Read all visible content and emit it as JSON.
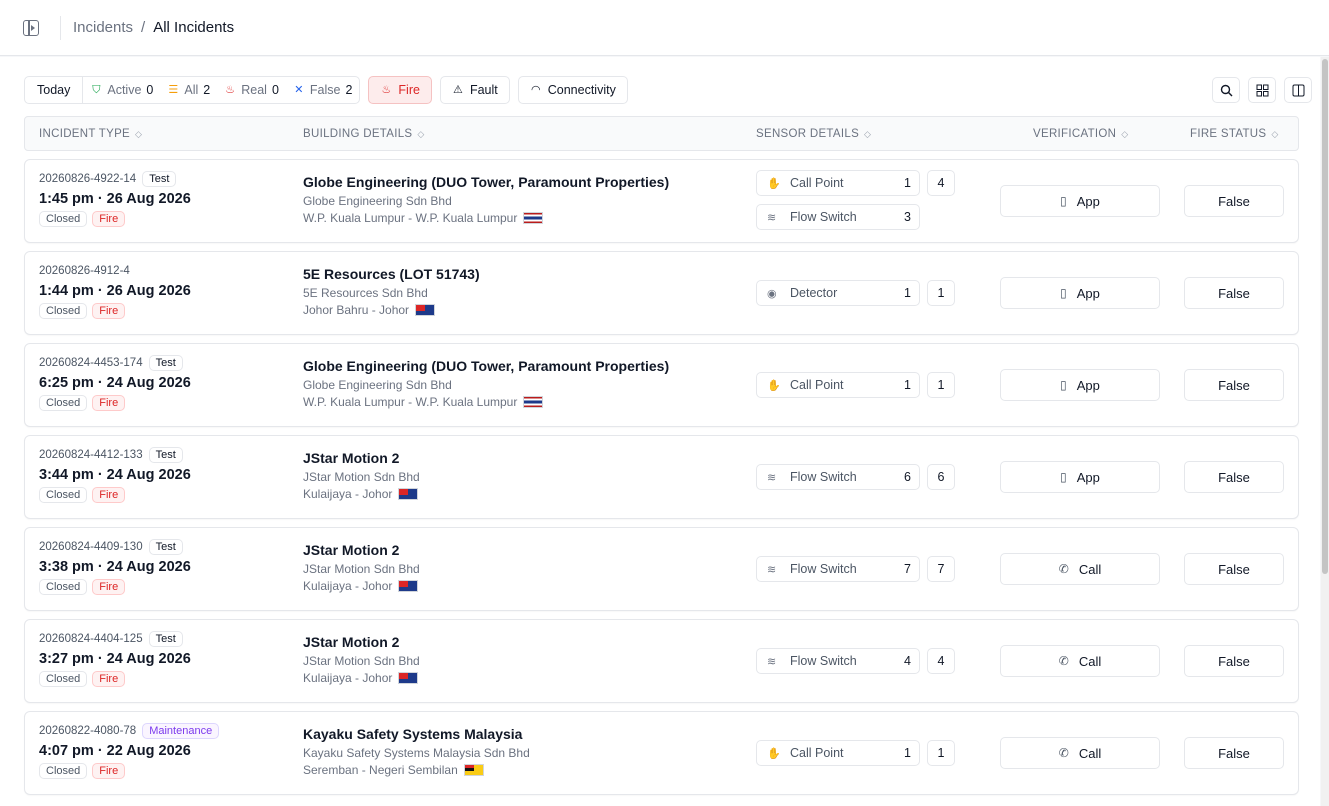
{
  "breadcrumb": {
    "parent": "Incidents",
    "separator": "/",
    "current": "All Incidents"
  },
  "filters": {
    "today": "Today",
    "active_label": "Active",
    "active_count": "0",
    "all_label": "All",
    "all_count": "2",
    "real_label": "Real",
    "real_count": "0",
    "false_label": "False",
    "false_count": "2",
    "fire": "Fire",
    "fault": "Fault",
    "connectivity": "Connectivity"
  },
  "columns": {
    "incident_type": "INCIDENT TYPE",
    "building_details": "BUILDING DETAILS",
    "sensor_details": "SENSOR DETAILS",
    "verification": "VERIFICATION",
    "fire_status": "FIRE STATUS"
  },
  "colors": {
    "fire": "#dc2626",
    "maintenance": "#7c3aed",
    "border": "#e5e7eb"
  },
  "rows": [
    {
      "id": "20260826-4922-14",
      "tag": "Test",
      "datetime": "1:45 pm · 26 Aug 2026",
      "status": "Closed",
      "type": "Fire",
      "building": "Globe Engineering (DUO Tower, Paramount Properties)",
      "company": "Globe Engineering Sdn Bhd",
      "location": "W.P. Kuala Lumpur - W.P. Kuala Lumpur",
      "sensors": [
        {
          "icon": "hand-icon",
          "name": "Call Point",
          "count": "1",
          "total": "4"
        },
        {
          "icon": "flow-icon",
          "name": "Flow Switch",
          "count": "3"
        }
      ],
      "verification": "App",
      "fire_status": "False"
    },
    {
      "id": "20260826-4912-4",
      "tag": "",
      "datetime": "1:44 pm · 26 Aug 2026",
      "status": "Closed",
      "type": "Fire",
      "building": "5E Resources (LOT 51743)",
      "company": "5E Resources Sdn Bhd",
      "location": "Johor Bahru - Johor",
      "sensors": [
        {
          "icon": "detector-icon",
          "name": "Detector",
          "count": "1",
          "total": "1"
        }
      ],
      "verification": "App",
      "fire_status": "False"
    },
    {
      "id": "20260824-4453-174",
      "tag": "Test",
      "datetime": "6:25 pm · 24 Aug 2026",
      "status": "Closed",
      "type": "Fire",
      "building": "Globe Engineering (DUO Tower, Paramount Properties)",
      "company": "Globe Engineering Sdn Bhd",
      "location": "W.P. Kuala Lumpur - W.P. Kuala Lumpur",
      "sensors": [
        {
          "icon": "hand-icon",
          "name": "Call Point",
          "count": "1",
          "total": "1"
        }
      ],
      "verification": "App",
      "fire_status": "False"
    },
    {
      "id": "20260824-4412-133",
      "tag": "Test",
      "datetime": "3:44 pm · 24 Aug 2026",
      "status": "Closed",
      "type": "Fire",
      "building": "JStar Motion 2",
      "company": "JStar Motion Sdn Bhd",
      "location": "Kulaijaya - Johor",
      "sensors": [
        {
          "icon": "flow-icon",
          "name": "Flow Switch",
          "count": "6",
          "total": "6"
        }
      ],
      "verification": "App",
      "fire_status": "False"
    },
    {
      "id": "20260824-4409-130",
      "tag": "Test",
      "datetime": "3:38 pm · 24 Aug 2026",
      "status": "Closed",
      "type": "Fire",
      "building": "JStar Motion 2",
      "company": "JStar Motion Sdn Bhd",
      "location": "Kulaijaya - Johor",
      "sensors": [
        {
          "icon": "flow-icon",
          "name": "Flow Switch",
          "count": "7",
          "total": "7"
        }
      ],
      "verification": "Call",
      "fire_status": "False"
    },
    {
      "id": "20260824-4404-125",
      "tag": "Test",
      "datetime": "3:27 pm · 24 Aug 2026",
      "status": "Closed",
      "type": "Fire",
      "building": "JStar Motion 2",
      "company": "JStar Motion Sdn Bhd",
      "location": "Kulaijaya - Johor",
      "sensors": [
        {
          "icon": "flow-icon",
          "name": "Flow Switch",
          "count": "4",
          "total": "4"
        }
      ],
      "verification": "Call",
      "fire_status": "False"
    },
    {
      "id": "20260822-4080-78",
      "tag": "Maintenance",
      "datetime": "4:07 pm · 22 Aug 2026",
      "status": "Closed",
      "type": "Fire",
      "building": "Kayaku Safety Systems Malaysia",
      "company": "Kayaku Safety Systems Malaysia Sdn Bhd",
      "location": "Seremban - Negeri Sembilan",
      "sensors": [
        {
          "icon": "hand-icon",
          "name": "Call Point",
          "count": "1",
          "total": "1"
        }
      ],
      "verification": "Call",
      "fire_status": "False"
    }
  ]
}
